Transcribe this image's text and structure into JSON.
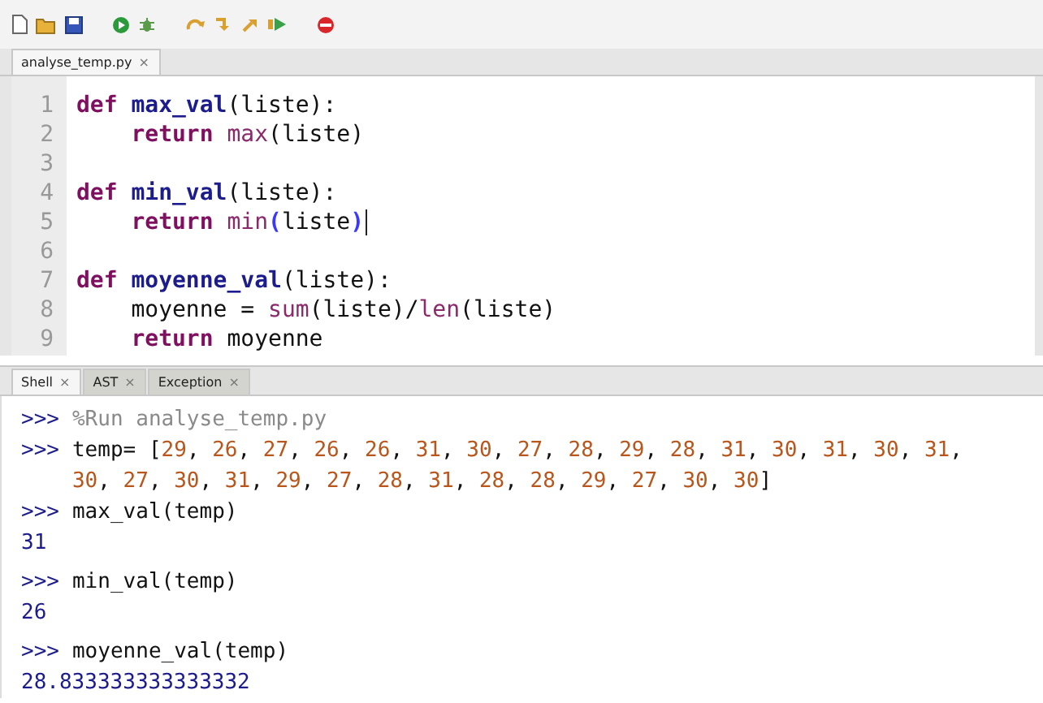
{
  "toolbar": {
    "buttons": [
      {
        "kind": "new"
      },
      {
        "kind": "open"
      },
      {
        "kind": "save"
      },
      {
        "kind": "run"
      },
      {
        "kind": "debug"
      },
      {
        "kind": "step-over"
      },
      {
        "kind": "step-into"
      },
      {
        "kind": "step-out"
      },
      {
        "kind": "resume"
      },
      {
        "kind": "stop"
      }
    ]
  },
  "editor_tabs": [
    {
      "label": "analyse_temp.py",
      "close": "×",
      "selected": true
    }
  ],
  "editor": {
    "lines": [
      {
        "number": "1",
        "tokens": [
          {
            "kind": "keyword",
            "text": "def "
          },
          {
            "kind": "defname",
            "text": "max_val"
          },
          {
            "kind": "plain",
            "text": "(liste):"
          }
        ]
      },
      {
        "number": "2",
        "tokens": [
          {
            "kind": "keyword",
            "text": "    return "
          },
          {
            "kind": "builtin",
            "text": "max"
          },
          {
            "kind": "plain",
            "text": "(liste)"
          }
        ]
      },
      {
        "number": "3"
      },
      {
        "number": "4",
        "tokens": [
          {
            "kind": "keyword",
            "text": "def "
          },
          {
            "kind": "defname",
            "text": "min_val"
          },
          {
            "kind": "plain",
            "text": "(liste):"
          }
        ]
      },
      {
        "number": "5",
        "cursor": true,
        "tokens": [
          {
            "kind": "keyword",
            "text": "    return "
          },
          {
            "kind": "builtin",
            "text": "min"
          },
          {
            "kind": "match",
            "text": "("
          },
          {
            "kind": "plain",
            "text": "liste"
          },
          {
            "kind": "match",
            "text": ")"
          }
        ]
      },
      {
        "number": "6"
      },
      {
        "number": "7",
        "tokens": [
          {
            "kind": "keyword",
            "text": "def "
          },
          {
            "kind": "defname",
            "text": "moyenne_val"
          },
          {
            "kind": "plain",
            "text": "(liste):"
          }
        ]
      },
      {
        "number": "8",
        "tokens": [
          {
            "kind": "plain",
            "text": "    moyenne = "
          },
          {
            "kind": "builtin",
            "text": "sum"
          },
          {
            "kind": "plain",
            "text": "(liste)/"
          },
          {
            "kind": "builtin",
            "text": "len"
          },
          {
            "kind": "plain",
            "text": "(liste)"
          }
        ]
      },
      {
        "number": "9",
        "tokens": [
          {
            "kind": "keyword",
            "text": "    return"
          },
          {
            "kind": "plain",
            "text": " moyenne"
          }
        ]
      }
    ]
  },
  "shell_tabs": [
    {
      "label": "Shell",
      "close": "×",
      "selected": true
    },
    {
      "label": "AST",
      "close": "×",
      "selected": false
    },
    {
      "label": "Exception",
      "close": "×",
      "selected": false
    }
  ],
  "shell": {
    "entries": [
      {
        "kind": "input",
        "prompt": ">>>",
        "tokens": [
          {
            "kind": "magic",
            "text": "%Run analyse_temp.py"
          }
        ]
      },
      {
        "kind": "input",
        "prompt": ">>>",
        "tokens": [
          {
            "kind": "plain",
            "text": "temp= ["
          },
          {
            "kind": "number",
            "text": "29"
          },
          {
            "kind": "plain",
            "text": ", "
          },
          {
            "kind": "number",
            "text": "26"
          },
          {
            "kind": "plain",
            "text": ", "
          },
          {
            "kind": "number",
            "text": "27"
          },
          {
            "kind": "plain",
            "text": ", "
          },
          {
            "kind": "number",
            "text": "26"
          },
          {
            "kind": "plain",
            "text": ", "
          },
          {
            "kind": "number",
            "text": "26"
          },
          {
            "kind": "plain",
            "text": ", "
          },
          {
            "kind": "number",
            "text": "31"
          },
          {
            "kind": "plain",
            "text": ", "
          },
          {
            "kind": "number",
            "text": "30"
          },
          {
            "kind": "plain",
            "text": ", "
          },
          {
            "kind": "number",
            "text": "27"
          },
          {
            "kind": "plain",
            "text": ", "
          },
          {
            "kind": "number",
            "text": "28"
          },
          {
            "kind": "plain",
            "text": ", "
          },
          {
            "kind": "number",
            "text": "29"
          },
          {
            "kind": "plain",
            "text": ", "
          },
          {
            "kind": "number",
            "text": "28"
          },
          {
            "kind": "plain",
            "text": ", "
          },
          {
            "kind": "number",
            "text": "31"
          },
          {
            "kind": "plain",
            "text": ", "
          },
          {
            "kind": "number",
            "text": "30"
          },
          {
            "kind": "plain",
            "text": ", "
          },
          {
            "kind": "number",
            "text": "31"
          },
          {
            "kind": "plain",
            "text": ", "
          },
          {
            "kind": "number",
            "text": "30"
          },
          {
            "kind": "plain",
            "text": ", "
          },
          {
            "kind": "number",
            "text": "31"
          },
          {
            "kind": "plain",
            "text": ", "
          },
          {
            "kind": "number",
            "text": "30"
          },
          {
            "kind": "plain",
            "text": ", "
          },
          {
            "kind": "number",
            "text": "27"
          },
          {
            "kind": "plain",
            "text": ", "
          },
          {
            "kind": "number",
            "text": "30"
          },
          {
            "kind": "plain",
            "text": ", "
          },
          {
            "kind": "number",
            "text": "31"
          },
          {
            "kind": "plain",
            "text": ", "
          },
          {
            "kind": "number",
            "text": "29"
          },
          {
            "kind": "plain",
            "text": ", "
          },
          {
            "kind": "number",
            "text": "27"
          },
          {
            "kind": "plain",
            "text": ", "
          },
          {
            "kind": "number",
            "text": "28"
          },
          {
            "kind": "plain",
            "text": ", "
          },
          {
            "kind": "number",
            "text": "31"
          },
          {
            "kind": "plain",
            "text": ", "
          },
          {
            "kind": "number",
            "text": "28"
          },
          {
            "kind": "plain",
            "text": ", "
          },
          {
            "kind": "number",
            "text": "28"
          },
          {
            "kind": "plain",
            "text": ", "
          },
          {
            "kind": "number",
            "text": "29"
          },
          {
            "kind": "plain",
            "text": ", "
          },
          {
            "kind": "number",
            "text": "27"
          },
          {
            "kind": "plain",
            "text": ", "
          },
          {
            "kind": "number",
            "text": "30"
          },
          {
            "kind": "plain",
            "text": ", "
          },
          {
            "kind": "number",
            "text": "30"
          },
          {
            "kind": "plain",
            "text": "]"
          }
        ]
      },
      {
        "kind": "input",
        "prompt": ">>>",
        "tokens": [
          {
            "kind": "plain",
            "text": "max_val(temp)"
          }
        ]
      },
      {
        "kind": "output",
        "text": "31"
      },
      {
        "kind": "input",
        "prompt": ">>>",
        "tokens": [
          {
            "kind": "plain",
            "text": "min_val(temp)"
          }
        ]
      },
      {
        "kind": "output",
        "text": "26"
      },
      {
        "kind": "input",
        "prompt": ">>>",
        "tokens": [
          {
            "kind": "plain",
            "text": "moyenne_val(temp)"
          }
        ]
      },
      {
        "kind": "output",
        "text": "28.833333333333332"
      }
    ]
  }
}
